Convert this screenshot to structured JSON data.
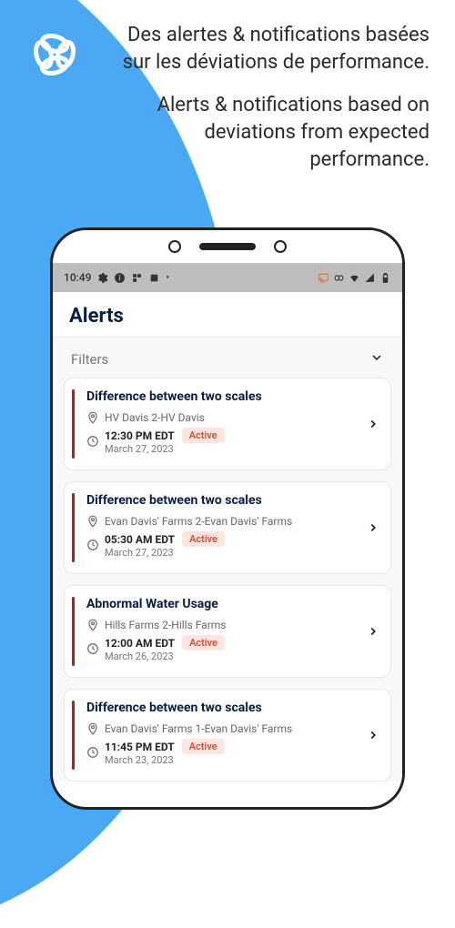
{
  "promo": {
    "fr": "Des alertes & notifications basées sur les déviations de performance.",
    "en": "Alerts & notifications based on deviations from expected performance."
  },
  "status": {
    "time": "10:49"
  },
  "header": {
    "title": "Alerts"
  },
  "filters": {
    "label": "Filters"
  },
  "badges": {
    "active": "Active"
  },
  "alerts": [
    {
      "title": "Difference between two scales",
      "location": "HV Davis 2-HV Davis",
      "time": "12:30 PM EDT",
      "date": "March 27, 2023",
      "status": "Active"
    },
    {
      "title": "Difference between two scales",
      "location": "Evan Davis' Farms 2-Evan Davis' Farms",
      "time": "05:30 AM EDT",
      "date": "March 27, 2023",
      "status": "Active"
    },
    {
      "title": "Abnormal Water Usage",
      "location": "Hills Farms 2-Hills Farms",
      "time": "12:00 AM EDT",
      "date": "March 26, 2023",
      "status": "Active"
    },
    {
      "title": "Difference between two scales",
      "location": "Evan Davis' Farms 1-Evan Davis' Farms",
      "time": "11:45 PM EDT",
      "date": "March 23, 2023",
      "status": "Active"
    }
  ]
}
